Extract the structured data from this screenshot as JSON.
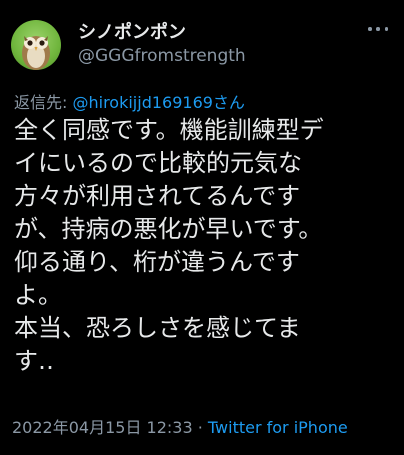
{
  "user": {
    "display_name": "シノポンポン",
    "handle": "@GGGfromstrength"
  },
  "reply": {
    "prefix": "返信先: ",
    "mention": "@hirokijjd169169さん"
  },
  "tweet": {
    "lines": [
      "全く同感です。機能訓練型デ",
      "イにいるので比較的元気な",
      "方々が利用されてるんです",
      "が、持病の悪化が早いです。",
      "仰る通り、桁が違うんです",
      "よ。",
      "本当、恐ろしさを感じてま",
      "す‥"
    ]
  },
  "meta": {
    "timestamp": "2022年04月15日 12:33",
    "separator": " · ",
    "source": "Twitter for iPhone"
  },
  "icons": {
    "avatar": "owl-avatar",
    "more": "more-options-icon"
  },
  "colors": {
    "background": "#000000",
    "text": "#e7e9ea",
    "secondary": "#8b98a5",
    "link": "#1d9bf0"
  }
}
